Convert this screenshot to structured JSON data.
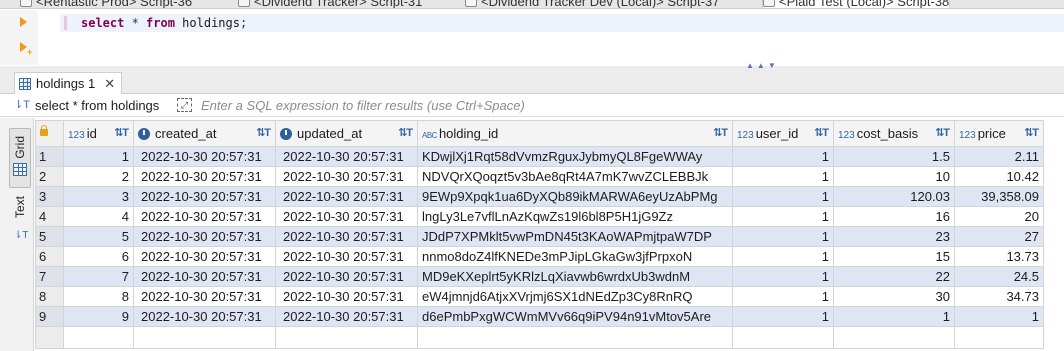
{
  "editor_tabs": [
    {
      "label": "<Rentastic Prod> Script-36"
    },
    {
      "label": "<Dividend Tracker> Script-31"
    },
    {
      "label": "<Dividend Tracker Dev (Local)> Script-37"
    },
    {
      "label": "<Plaid Test (Local)> Script-38"
    }
  ],
  "editor": {
    "keyword_select": "select",
    "star": " * ",
    "keyword_from": "from",
    "table": " holdings",
    "semicolon": ";"
  },
  "results_tab": {
    "label": "holdings 1",
    "close": "✕"
  },
  "filter": {
    "query_prefix": "select * from ",
    "query_table": "holdings",
    "placeholder": "Enter a SQL expression to filter results (use Ctrl+Space)"
  },
  "side_toolbar": {
    "grid_label": "Grid",
    "text_label": "Text"
  },
  "columns": [
    {
      "type_badge": "123",
      "label": "id"
    },
    {
      "type_badge": "clock-icon",
      "label": "created_at"
    },
    {
      "type_badge": "clock-icon",
      "label": "updated_at"
    },
    {
      "type_badge": "ABC",
      "label": "holding_id"
    },
    {
      "type_badge": "123",
      "label": "user_id"
    },
    {
      "type_badge": "123",
      "label": "cost_basis"
    },
    {
      "type_badge": "123",
      "label": "price"
    }
  ],
  "rows": [
    {
      "n": "1",
      "id": "1",
      "created_at": "2022-10-30 20:57:31",
      "updated_at": "2022-10-30 20:57:31",
      "holding_id": "KDwjlXj1Rqt58dVvmzRguxJybmyQL8FgeWWAy",
      "user_id": "1",
      "cost_basis": "1.5",
      "price": "2.11"
    },
    {
      "n": "2",
      "id": "2",
      "created_at": "2022-10-30 20:57:31",
      "updated_at": "2022-10-30 20:57:31",
      "holding_id": "NDVQrXQoqzt5v3bAe8qRt4A7mK7wvZCLEBBJk",
      "user_id": "1",
      "cost_basis": "10",
      "price": "10.42"
    },
    {
      "n": "3",
      "id": "3",
      "created_at": "2022-10-30 20:57:31",
      "updated_at": "2022-10-30 20:57:31",
      "holding_id": "9EWp9Xpqk1ua6DyXQb89ikMARWA6eyUzAbPMg",
      "user_id": "1",
      "cost_basis": "120.03",
      "price": "39,358.09"
    },
    {
      "n": "4",
      "id": "4",
      "created_at": "2022-10-30 20:57:31",
      "updated_at": "2022-10-30 20:57:31",
      "holding_id": "lngLy3Le7vflLnAzKqwZs19l6bl8P5H1jG9Zz",
      "user_id": "1",
      "cost_basis": "16",
      "price": "20"
    },
    {
      "n": "5",
      "id": "5",
      "created_at": "2022-10-30 20:57:31",
      "updated_at": "2022-10-30 20:57:31",
      "holding_id": "JDdP7XPMklt5vwPmDN45t3KAoWAPmjtpaW7DP",
      "user_id": "1",
      "cost_basis": "23",
      "price": "27"
    },
    {
      "n": "6",
      "id": "6",
      "created_at": "2022-10-30 20:57:31",
      "updated_at": "2022-10-30 20:57:31",
      "holding_id": "nnmo8doZ4lfKNEDe3mPJipLGkaGw3jfPrpxoN",
      "user_id": "1",
      "cost_basis": "15",
      "price": "13.73"
    },
    {
      "n": "7",
      "id": "7",
      "created_at": "2022-10-30 20:57:31",
      "updated_at": "2022-10-30 20:57:31",
      "holding_id": "MD9eKXeplrt5yKRlzLqXiavwb6wrdxUb3wdnM",
      "user_id": "1",
      "cost_basis": "22",
      "price": "24.5"
    },
    {
      "n": "8",
      "id": "8",
      "created_at": "2022-10-30 20:57:31",
      "updated_at": "2022-10-30 20:57:31",
      "holding_id": "eW4jmnjd6AtjxXVrjmj6SX1dNEdZp3Cy8RnRQ",
      "user_id": "1",
      "cost_basis": "30",
      "price": "34.73"
    },
    {
      "n": "9",
      "id": "9",
      "created_at": "2022-10-30 20:57:31",
      "updated_at": "2022-10-30 20:57:31",
      "holding_id": "d6ePmbPxgWCWmMVv66q9iPV94n91vMtov5Are",
      "user_id": "1",
      "cost_basis": "1",
      "price": "1"
    }
  ],
  "colors": {
    "keyword": "#7f0055",
    "accent": "#2f66a8",
    "row_stripe": "#dfe6f3",
    "marker": "#f29a18"
  }
}
